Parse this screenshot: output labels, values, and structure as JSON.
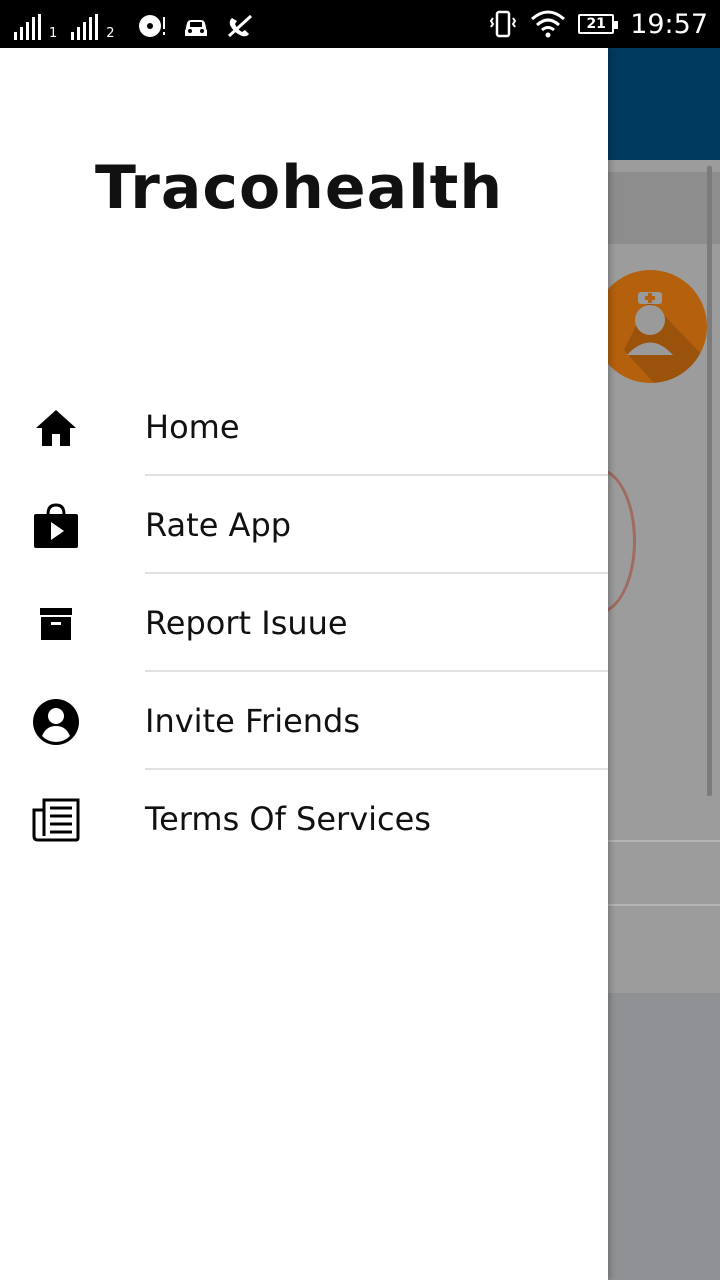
{
  "status_bar": {
    "sim1_label": "1",
    "sim2_label": "2",
    "battery_level": "21",
    "time": "19:57"
  },
  "drawer": {
    "brand": "Tracohealth",
    "menu": [
      {
        "label": "Home",
        "icon": "home-icon"
      },
      {
        "label": "Rate App",
        "icon": "play-store-bag-icon"
      },
      {
        "label": "Report Isuue",
        "icon": "archive-box-icon"
      },
      {
        "label": "Invite Friends",
        "icon": "account-circle-icon"
      },
      {
        "label": "Terms Of Services",
        "icon": "newspaper-icon"
      }
    ]
  },
  "colors": {
    "header_blue": "#003a5e",
    "avatar_orange": "#b4600d",
    "drawer_bg": "#ffffff",
    "divider": "#e0e0e0"
  }
}
